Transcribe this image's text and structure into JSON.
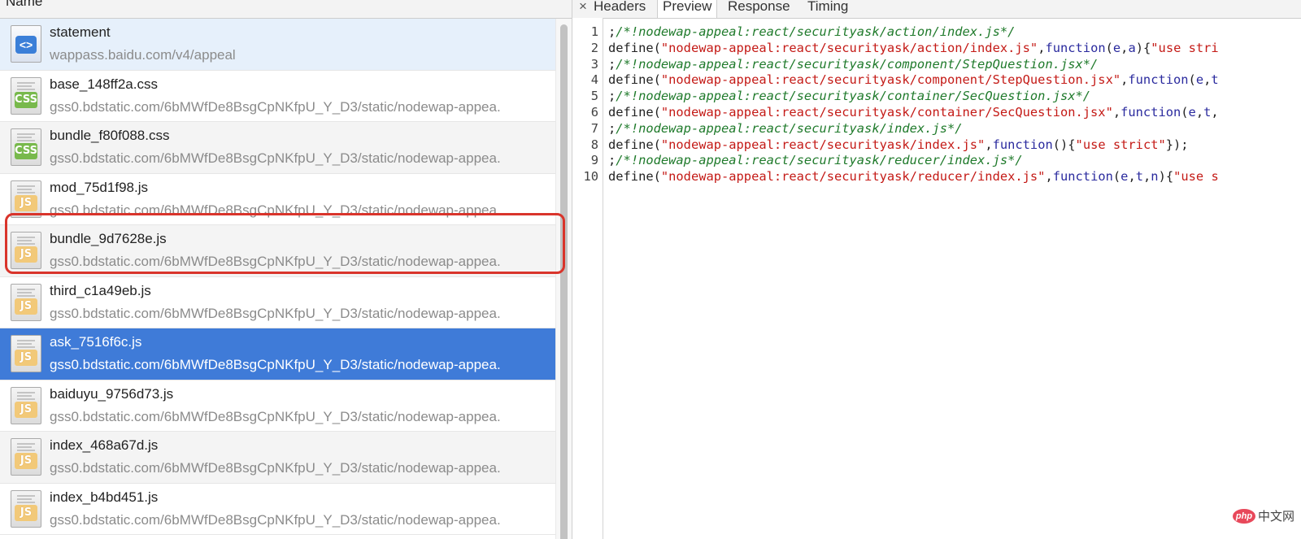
{
  "left": {
    "column_header": "Name",
    "rows": [
      {
        "name": "statement",
        "path": "wappass.baidu.com/v4/appeal",
        "icon": "document-icon"
      },
      {
        "name": "base_148ff2a.css",
        "path": "gss0.bdstatic.com/6bMWfDe8BsgCpNKfpU_Y_D3/static/nodewap-appea.",
        "icon": "css-file-icon",
        "tag": "CSS"
      },
      {
        "name": "bundle_f80f088.css",
        "path": "gss0.bdstatic.com/6bMWfDe8BsgCpNKfpU_Y_D3/static/nodewap-appea.",
        "icon": "css-file-icon",
        "tag": "CSS"
      },
      {
        "name": "mod_75d1f98.js",
        "path": "gss0.bdstatic.com/6bMWfDe8BsgCpNKfpU_Y_D3/static/nodewap-appea.",
        "icon": "js-file-icon",
        "tag": "JS"
      },
      {
        "name": "bundle_9d7628e.js",
        "path": "gss0.bdstatic.com/6bMWfDe8BsgCpNKfpU_Y_D3/static/nodewap-appea.",
        "icon": "js-file-icon",
        "tag": "JS"
      },
      {
        "name": "third_c1a49eb.js",
        "path": "gss0.bdstatic.com/6bMWfDe8BsgCpNKfpU_Y_D3/static/nodewap-appea.",
        "icon": "js-file-icon",
        "tag": "JS"
      },
      {
        "name": "ask_7516f6c.js",
        "path": "gss0.bdstatic.com/6bMWfDe8BsgCpNKfpU_Y_D3/static/nodewap-appea.",
        "icon": "js-file-icon",
        "tag": "JS"
      },
      {
        "name": "baiduyu_9756d73.js",
        "path": "gss0.bdstatic.com/6bMWfDe8BsgCpNKfpU_Y_D3/static/nodewap-appea.",
        "icon": "js-file-icon",
        "tag": "JS"
      },
      {
        "name": "index_468a67d.js",
        "path": "gss0.bdstatic.com/6bMWfDe8BsgCpNKfpU_Y_D3/static/nodewap-appea.",
        "icon": "js-file-icon",
        "tag": "JS"
      },
      {
        "name": "index_b4bd451.js",
        "path": "gss0.bdstatic.com/6bMWfDe8BsgCpNKfpU_Y_D3/static/nodewap-appea.",
        "icon": "js-file-icon",
        "tag": "JS"
      }
    ],
    "selected_row": "ask_7516f6c.js",
    "highlighted_row": "bundle_9d7628e.js"
  },
  "right": {
    "close_symbol": "×",
    "tabs": [
      "Headers",
      "Preview",
      "Response",
      "Timing"
    ],
    "active_tab": "Preview",
    "code_lines": [
      {
        "num": "1",
        "parts": [
          [
            "p",
            ";"
          ],
          [
            "cm",
            "/*!nodewap-appeal:react/securityask/action/index.js*/"
          ]
        ]
      },
      {
        "num": "2",
        "parts": [
          [
            "p",
            "define("
          ],
          [
            "str",
            "\"nodewap-appeal:react/securityask/action/index.js\""
          ],
          [
            "p",
            ","
          ],
          [
            "kw",
            "function"
          ],
          [
            "p",
            "("
          ],
          [
            "kw",
            "e"
          ],
          [
            "p",
            ","
          ],
          [
            "kw",
            "a"
          ],
          [
            "p",
            "){"
          ],
          [
            "str",
            "\"use stri"
          ]
        ]
      },
      {
        "num": "3",
        "parts": [
          [
            "p",
            ";"
          ],
          [
            "cm",
            "/*!nodewap-appeal:react/securityask/component/StepQuestion.jsx*/"
          ]
        ]
      },
      {
        "num": "4",
        "parts": [
          [
            "p",
            "define("
          ],
          [
            "str",
            "\"nodewap-appeal:react/securityask/component/StepQuestion.jsx\""
          ],
          [
            "p",
            ","
          ],
          [
            "kw",
            "function"
          ],
          [
            "p",
            "("
          ],
          [
            "kw",
            "e"
          ],
          [
            "p",
            ","
          ],
          [
            "kw",
            "t"
          ]
        ]
      },
      {
        "num": "5",
        "parts": [
          [
            "p",
            ";"
          ],
          [
            "cm",
            "/*!nodewap-appeal:react/securityask/container/SecQuestion.jsx*/"
          ]
        ]
      },
      {
        "num": "6",
        "parts": [
          [
            "p",
            "define("
          ],
          [
            "str",
            "\"nodewap-appeal:react/securityask/container/SecQuestion.jsx\""
          ],
          [
            "p",
            ","
          ],
          [
            "kw",
            "function"
          ],
          [
            "p",
            "("
          ],
          [
            "kw",
            "e"
          ],
          [
            "p",
            ","
          ],
          [
            "kw",
            "t"
          ],
          [
            "p",
            ","
          ]
        ]
      },
      {
        "num": "7",
        "parts": [
          [
            "p",
            ";"
          ],
          [
            "cm",
            "/*!nodewap-appeal:react/securityask/index.js*/"
          ]
        ]
      },
      {
        "num": "8",
        "parts": [
          [
            "p",
            "define("
          ],
          [
            "str",
            "\"nodewap-appeal:react/securityask/index.js\""
          ],
          [
            "p",
            ","
          ],
          [
            "kw",
            "function"
          ],
          [
            "p",
            "(){"
          ],
          [
            "str",
            "\"use strict\""
          ],
          [
            "p",
            "});"
          ]
        ]
      },
      {
        "num": "9",
        "parts": [
          [
            "p",
            ";"
          ],
          [
            "cm",
            "/*!nodewap-appeal:react/securityask/reducer/index.js*/"
          ]
        ]
      },
      {
        "num": "10",
        "parts": [
          [
            "p",
            "define("
          ],
          [
            "str",
            "\"nodewap-appeal:react/securityask/reducer/index.js\""
          ],
          [
            "p",
            ","
          ],
          [
            "kw",
            "function"
          ],
          [
            "p",
            "("
          ],
          [
            "kw",
            "e"
          ],
          [
            "p",
            ","
          ],
          [
            "kw",
            "t"
          ],
          [
            "p",
            ","
          ],
          [
            "kw",
            "n"
          ],
          [
            "p",
            "){"
          ],
          [
            "str",
            "\"use s"
          ]
        ]
      }
    ]
  },
  "watermark": {
    "logo": "php",
    "text": "中文网"
  },
  "colors": {
    "selected_row": "#3f7bd8",
    "highlight_box": "#d9342b",
    "comment": "#1f7a2b",
    "string": "#c41a16",
    "keyword": "#2a2a9e"
  }
}
